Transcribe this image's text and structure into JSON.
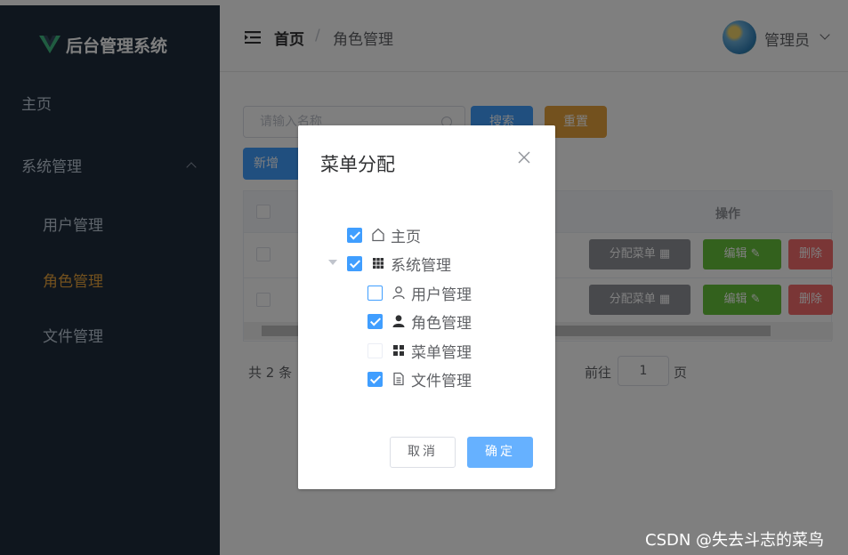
{
  "app": {
    "title": "后台管理系统",
    "logo_icon": "vue-logo-icon"
  },
  "sidebar": {
    "items": [
      {
        "label": "主页"
      },
      {
        "label": "系统管理"
      },
      {
        "label": "用户管理"
      },
      {
        "label": "角色管理",
        "active": true
      },
      {
        "label": "文件管理"
      }
    ]
  },
  "header": {
    "breadcrumb": {
      "home": "首页",
      "separator": "/",
      "current": "角色管理"
    },
    "user": {
      "name": "管理员"
    }
  },
  "toolbar": {
    "search_placeholder": "请输入名称",
    "search_label": "搜索",
    "reset_label": "重置",
    "add_label": "新增"
  },
  "table": {
    "op_header": "操作",
    "rows": [
      {
        "assign": "分配菜单",
        "edit": "编辑",
        "delete": "删除"
      },
      {
        "assign": "分配菜单",
        "edit": "编辑",
        "delete": "删除"
      }
    ]
  },
  "pager": {
    "total": "共 2 条",
    "goto": "前往",
    "page": "1",
    "page_unit": "页"
  },
  "dialog": {
    "title": "菜单分配",
    "tree": [
      {
        "label": "主页",
        "icon": "home-icon",
        "checked": true
      },
      {
        "label": "系统管理",
        "icon": "grid-icon",
        "checked": true
      },
      {
        "label": "用户管理",
        "icon": "user-outline-icon",
        "checked": false
      },
      {
        "label": "角色管理",
        "icon": "user-solid-icon",
        "checked": true
      },
      {
        "label": "菜单管理",
        "icon": "menu-grid-icon",
        "checked": false
      },
      {
        "label": "文件管理",
        "icon": "document-icon",
        "checked": true
      }
    ],
    "cancel_label": "取消",
    "ok_label": "确定"
  },
  "watermark": "CSDN @失去斗志的菜鸟",
  "colors": {
    "sidebar_bg": "#1f2d3d",
    "primary": "#409eff",
    "warning": "#e6a23c",
    "success": "#67c23a",
    "danger": "#f56c6c",
    "active_menu": "#e6a23c"
  }
}
